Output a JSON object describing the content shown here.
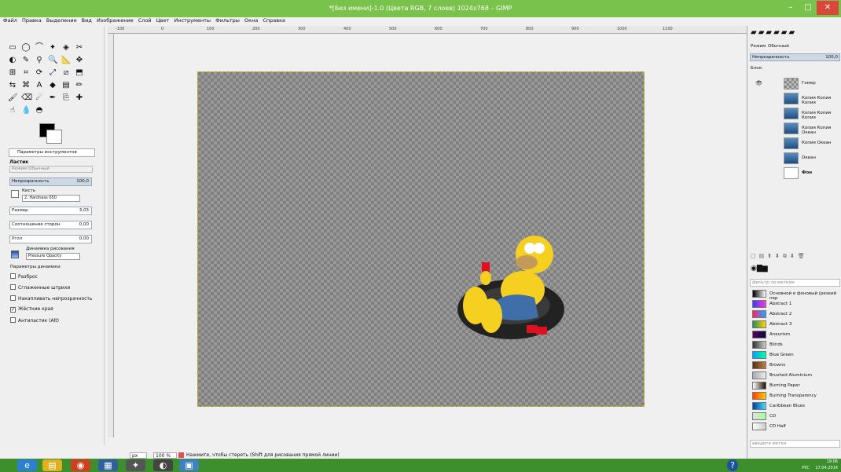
{
  "window": {
    "title": "*[Без имени]-1.0 (Цвета RGB, 7 слоев) 1024x768 – GIMP",
    "minimize_glyph": "–",
    "maximize_glyph": "□",
    "close_glyph": "✕"
  },
  "menubar": {
    "items": [
      "Файл",
      "Правка",
      "Выделение",
      "Вид",
      "Изображение",
      "Слой",
      "Цвет",
      "Инструменты",
      "Фильтры",
      "Окна",
      "Справка"
    ]
  },
  "ruler": {
    "ticks": [
      "-100",
      "0",
      "100",
      "200",
      "300",
      "400",
      "500",
      "600",
      "700",
      "800",
      "900",
      "1000",
      "1100"
    ]
  },
  "toolbox": {
    "tool_icons": [
      "rect-select-icon",
      "ellipse-select-icon",
      "lasso-icon",
      "fuzzy-select-icon",
      "color-select-icon",
      "scissors-icon",
      "foreground-select-icon",
      "paths-icon",
      "color-picker-icon",
      "zoom-icon",
      "measure-icon",
      "move-icon",
      "align-icon",
      "crop-icon",
      "rotate-icon",
      "scale-icon",
      "shear-icon",
      "perspective-icon",
      "flip-icon",
      "cage-icon",
      "text-icon",
      "bucket-icon",
      "blend-icon",
      "pencil-icon",
      "brush-icon",
      "eraser-icon",
      "airbrush-icon",
      "ink-icon",
      "clone-icon",
      "heal-icon",
      "smudge-icon",
      "blur-icon",
      "dodge-icon"
    ],
    "tool_glyphs": [
      "▭",
      "◯",
      "⌒",
      "✦",
      "◈",
      "✂",
      "◐",
      "✎",
      "⚲",
      "🔍",
      "📐",
      "✥",
      "⊞",
      "⌗",
      "⟳",
      "⤢",
      "⧄",
      "⬒",
      "⇆",
      "⌘",
      "A",
      "◆",
      "▤",
      "✏",
      "🖌",
      "⌫",
      "☄",
      "✒",
      "⎘",
      "✚",
      "☝",
      "💧",
      "◓"
    ]
  },
  "tool_options": {
    "tab_label": "Параметры инструментов",
    "tool_name": "Ластик",
    "mode_label": "Режим",
    "mode_value": "Обычный",
    "opacity_label": "Непрозрачность",
    "opacity_value": "100,0",
    "brush_label": "Кисть",
    "brush_value": "2. Hardness 050",
    "size_label": "Размер",
    "size_value": "3,03",
    "aspect_label": "Соотношение сторон",
    "aspect_value": "0,00",
    "angle_label": "Угол",
    "angle_value": "0,00",
    "dynamics_label": "Динамика рисования",
    "dynamics_value": "Pressure Opacity",
    "dynamics_params": "Параметры динамики",
    "options": [
      {
        "label": "Разброс",
        "checked": false
      },
      {
        "label": "Сглаженные штрихи",
        "checked": false
      },
      {
        "label": "Накапливать непрозрачность",
        "checked": false
      },
      {
        "label": "Жёсткие края",
        "checked": true
      },
      {
        "label": "Антиластик (Alt)",
        "checked": false
      }
    ]
  },
  "statusbar": {
    "unit": "px",
    "zoom": "100 %",
    "message": "Нажмите, чтобы стереть (Shift для рисования прямой линии)"
  },
  "layers_panel": {
    "mode_label": "Режим",
    "mode_value": "Обычный",
    "opacity_label": "Непрозрачность",
    "opacity_value": "100,0",
    "lock_label": "Блок:",
    "layers": [
      {
        "name": "Гомер"
      },
      {
        "name": "Копия Копия Копия"
      },
      {
        "name": "Копия Копия Копия"
      },
      {
        "name": "Копия Копия Океан"
      },
      {
        "name": "Копия Океан"
      },
      {
        "name": "Океан"
      },
      {
        "name": "Фон"
      }
    ]
  },
  "gradients_panel": {
    "filter_placeholder": "фильтр по меткам",
    "tag_placeholder": "введите метки",
    "items": [
      {
        "name": "Основной в фоновый (резкий пер",
        "colors": [
          "#000000",
          "#ffffff"
        ]
      },
      {
        "name": "Abstract 1",
        "colors": [
          "#3a3aff",
          "#ff3ad0"
        ]
      },
      {
        "name": "Abstract 2",
        "colors": [
          "#ff1f6a",
          "#1faaff"
        ]
      },
      {
        "name": "Abstract 3",
        "colors": [
          "#2e8b57",
          "#ffd700"
        ]
      },
      {
        "name": "Aneurism",
        "colors": [
          "#5a005a",
          "#0a0a40"
        ]
      },
      {
        "name": "Blinds",
        "colors": [
          "#333333",
          "#cccccc"
        ]
      },
      {
        "name": "Blue Green",
        "colors": [
          "#00a0ff",
          "#00ffa0"
        ]
      },
      {
        "name": "Browns",
        "colors": [
          "#5a3010",
          "#c08040"
        ]
      },
      {
        "name": "Brushed Aluminium",
        "colors": [
          "#aaaaaa",
          "#eeeeee"
        ]
      },
      {
        "name": "Burning Paper",
        "colors": [
          "#ffffff",
          "#221100"
        ]
      },
      {
        "name": "Burning Transparency",
        "colors": [
          "#ff4000",
          "#ffcc00"
        ]
      },
      {
        "name": "Caribbean Blues",
        "colors": [
          "#0040a0",
          "#40e0ff"
        ]
      },
      {
        "name": "CD",
        "colors": [
          "#e0e0e0",
          "#a0ffa0"
        ]
      },
      {
        "name": "CD Half",
        "colors": [
          "#ffffff",
          "#cccccc"
        ]
      }
    ]
  },
  "taskbar": {
    "time": "19:06",
    "date": "17.04.2014",
    "lang": "РУС"
  },
  "colors": {
    "titlebar": "#79c24b",
    "taskbar": "#3d8f2d",
    "close": "#d9473b"
  }
}
